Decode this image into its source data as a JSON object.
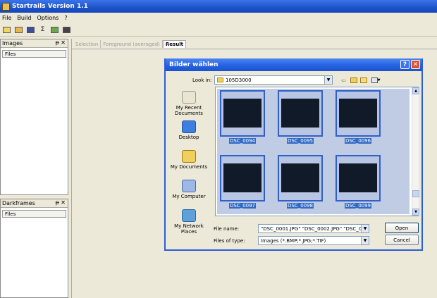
{
  "app": {
    "title": "Startrails Version 1.1"
  },
  "menu": [
    "File",
    "Build",
    "Options",
    "?"
  ],
  "toolbar": [
    "new-icon",
    "open-icon",
    "save-icon",
    "sum-icon",
    "image-icon",
    "video-icon"
  ],
  "toolbar_sum_glyph": "Σ",
  "images_panel": {
    "title": "Images",
    "pin": "ᵽ",
    "close": "✕",
    "column": "Files"
  },
  "darkframes_panel": {
    "title": "Darkframes",
    "pin": "ᵽ",
    "close": "✕",
    "column": "Files"
  },
  "tabs": [
    {
      "label": "Selection",
      "active": false
    },
    {
      "label": "Foreground (averaged)",
      "active": false
    },
    {
      "label": "Result",
      "active": true
    }
  ],
  "dialog": {
    "title": "Bilder wählen",
    "help": "?",
    "close": "✕",
    "lookin_label": "Look in:",
    "lookin_value": "105D3000",
    "places": [
      {
        "label": "My Recent Documents"
      },
      {
        "label": "Desktop"
      },
      {
        "label": "My Documents"
      },
      {
        "label": "My Computer"
      },
      {
        "label": "My Network Places"
      }
    ],
    "files": [
      "DSC_0094",
      "DSC_0095",
      "DSC_0096",
      "DSC_0097",
      "DSC_0098",
      "DSC_0099"
    ],
    "filename_label": "File name:",
    "filename_value": "\"DSC_0001.JPG\" \"DSC_0002.JPG\" \"DSC_00",
    "filetype_label": "Files of type:",
    "filetype_value": "Images (*.BMP;*.JPG;*.TIF)",
    "open_label": "Open",
    "cancel_label": "Cancel"
  },
  "colors": {
    "selection": "#316ac5",
    "titlebar": "#1e52c9",
    "thumbnail": "#111a28"
  }
}
